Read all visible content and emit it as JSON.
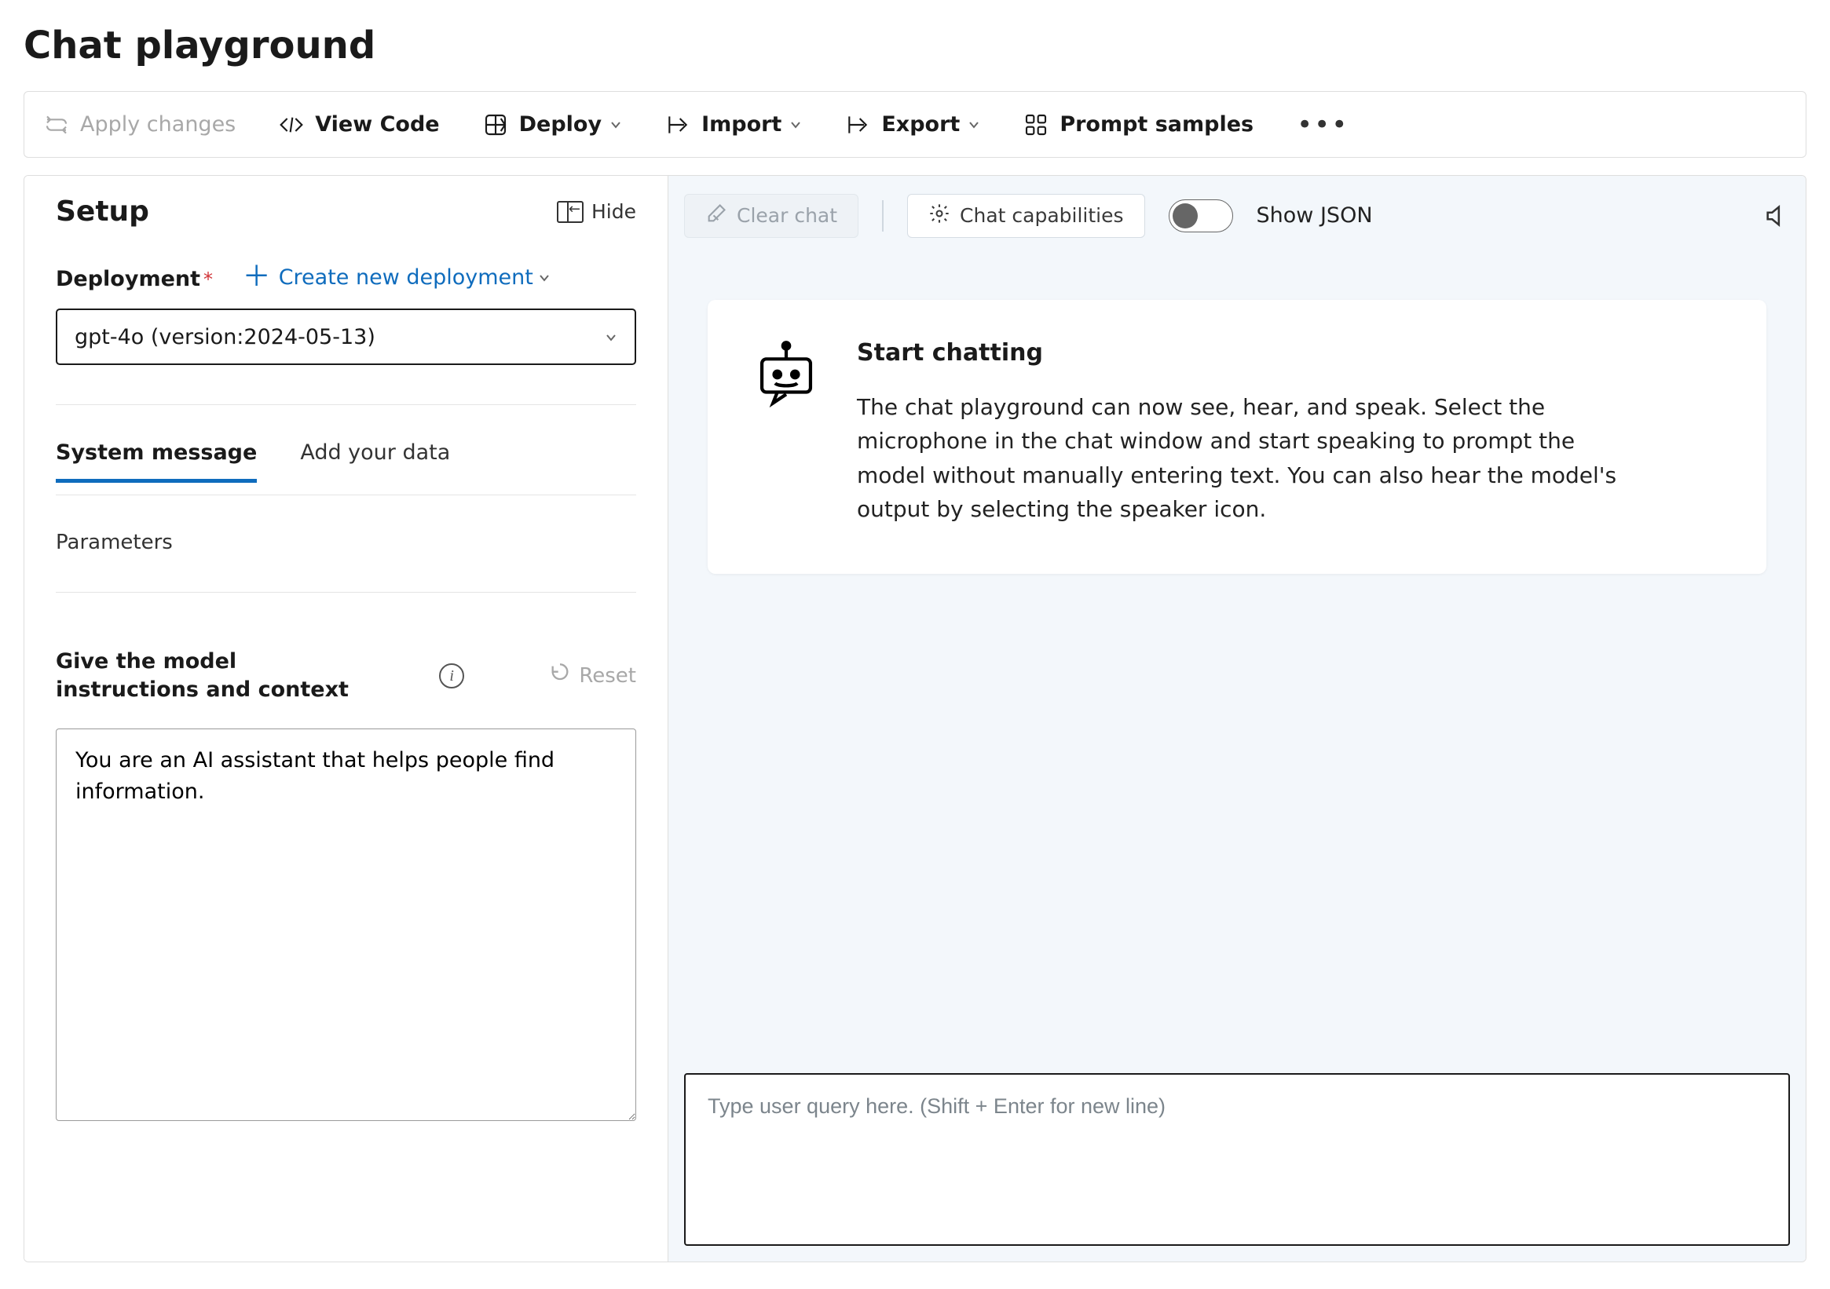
{
  "page": {
    "title": "Chat playground"
  },
  "toolbar": {
    "apply": "Apply changes",
    "viewCode": "View Code",
    "deploy": "Deploy",
    "import": "Import",
    "export": "Export",
    "samples": "Prompt samples"
  },
  "setup": {
    "title": "Setup",
    "hide": "Hide",
    "deploymentLabel": "Deployment",
    "createNew": "Create new deployment",
    "deploymentValue": "gpt-4o (version:2024-05-13)",
    "tabs": {
      "system": "System message",
      "data": "Add your data"
    },
    "parameters": "Parameters",
    "instructionsLabel": "Give the model instructions and context",
    "reset": "Reset",
    "systemMessage": "You are an AI assistant that helps people find information."
  },
  "chatTop": {
    "clear": "Clear chat",
    "caps": "Chat capabilities",
    "showJson": "Show JSON"
  },
  "card": {
    "title": "Start chatting",
    "body": "The chat playground can now see, hear, and speak. Select the microphone in the chat window and start speaking to prompt the model without manually entering text. You can also hear the model's output by selecting the speaker icon."
  },
  "input": {
    "placeholder": "Type user query here. (Shift + Enter for new line)"
  }
}
